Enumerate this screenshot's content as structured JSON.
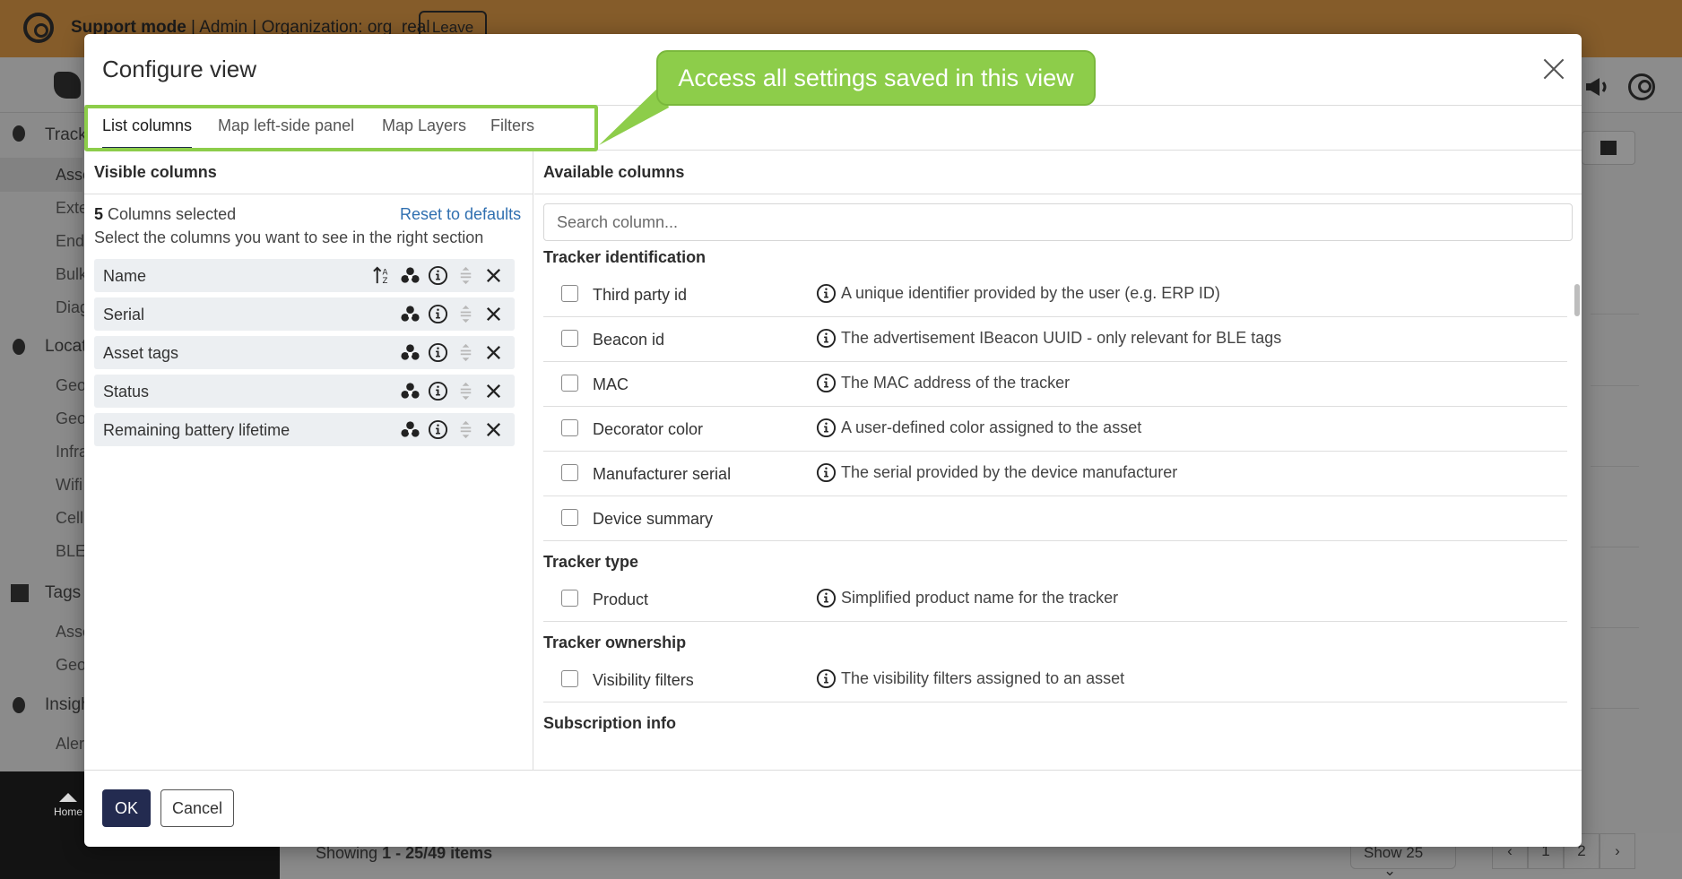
{
  "support_bar": {
    "mode_label": "Support mode",
    "details": " | Admin | Organization: org_real",
    "leave_label": "Leave"
  },
  "sidebar": {
    "groups": [
      {
        "label": "Track"
      },
      {
        "label": "Locat"
      },
      {
        "label": "Tags"
      },
      {
        "label": "Insigh"
      }
    ],
    "items": [
      "Asse",
      "Exte",
      "End",
      "Bulk",
      "Diag",
      "Geo",
      "Geo",
      "Infra",
      "Wifi",
      "Cell",
      "BLE",
      "Asse",
      "Geo",
      "Aler"
    ],
    "home_label": "Home"
  },
  "background_footer": {
    "showing_prefix": "Showing ",
    "showing_range": "1 - 25/49 items",
    "show_select": "Show 25",
    "pages": [
      "‹",
      "1",
      "2",
      "›"
    ]
  },
  "modal": {
    "title": "Configure view",
    "callout": "Access all settings saved in this view",
    "tabs": [
      "List columns",
      "Map left-side panel",
      "Map Layers",
      "Filters"
    ],
    "active_tab": "List columns",
    "left": {
      "heading": "Visible columns",
      "count": "5",
      "count_suffix": " Columns selected",
      "reset_label": "Reset to defaults",
      "hint": "Select the columns you want to see in the right section",
      "columns": [
        {
          "label": "Name",
          "sortable": true
        },
        {
          "label": "Serial",
          "sortable": false
        },
        {
          "label": "Asset tags",
          "sortable": false
        },
        {
          "label": "Status",
          "sortable": false
        },
        {
          "label": "Remaining battery lifetime",
          "sortable": false
        }
      ]
    },
    "right": {
      "heading": "Available columns",
      "search_placeholder": "Search column...",
      "groups": [
        {
          "title": "Tracker identification",
          "rows": [
            {
              "name": "Third party id",
              "desc": "A unique identifier provided by the user (e.g. ERP ID)"
            },
            {
              "name": "Beacon id",
              "desc": "The advertisement IBeacon UUID - only relevant for BLE tags"
            },
            {
              "name": "MAC",
              "desc": "The MAC address of the tracker"
            },
            {
              "name": "Decorator color",
              "desc": "A user-defined color assigned to the asset"
            },
            {
              "name": "Manufacturer serial",
              "desc": "The serial provided by the device manufacturer"
            },
            {
              "name": "Device summary",
              "desc": ""
            }
          ]
        },
        {
          "title": "Tracker type",
          "rows": [
            {
              "name": "Product",
              "desc": "Simplified product name for the tracker"
            }
          ]
        },
        {
          "title": "Tracker ownership",
          "rows": [
            {
              "name": "Visibility filters",
              "desc": "The visibility filters assigned to an asset"
            }
          ]
        },
        {
          "title": "Subscription info",
          "rows": []
        }
      ]
    },
    "ok_label": "OK",
    "cancel_label": "Cancel"
  },
  "colors": {
    "support_bar": "#855c2a",
    "primary_button": "#232b50",
    "highlight": "#8dcd4a",
    "link": "#2f6fb0"
  },
  "icons": [
    "support-icon",
    "app-logo",
    "megaphone-icon",
    "user-icon",
    "map-icon",
    "sort-az-icon",
    "group-icon",
    "info-icon",
    "drag-handle-icon",
    "remove-icon",
    "close-icon",
    "home-icon"
  ]
}
